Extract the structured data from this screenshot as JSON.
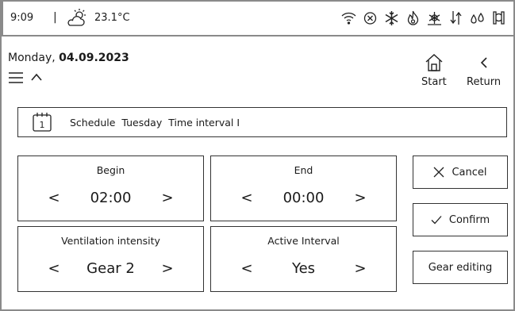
{
  "status_bar": {
    "time": "9:09",
    "separator": "|",
    "weather_icon": "sun-cloud-icon",
    "temperature": "23.1°C",
    "icons": [
      "wifi-icon",
      "circle-x-icon",
      "snowflake-icon",
      "flame-icon",
      "defrost-icon",
      "airflow-icon",
      "water-drops-icon",
      "filter-icon"
    ]
  },
  "header": {
    "date_prefix": "Monday,",
    "date": "04.09.2023",
    "nav": {
      "start_label": "Start",
      "return_label": "Return"
    }
  },
  "schedule": {
    "calendar_day": "1",
    "text": "Schedule  Tuesday  Time interval I"
  },
  "tiles": {
    "begin": {
      "label": "Begin",
      "value": "02:00"
    },
    "end": {
      "label": "End",
      "value": "00:00"
    },
    "ventilation": {
      "label": "Ventilation intensity",
      "value": "Gear 2"
    },
    "active": {
      "label": "Active Interval",
      "value": "Yes"
    },
    "arrow_left": "<",
    "arrow_right": ">"
  },
  "actions": {
    "cancel": "Cancel",
    "confirm": "Confirm",
    "gear_editing": "Gear editing"
  },
  "colors": {
    "border": "#333333",
    "frame": "#8a8a8a",
    "text": "#1a1a1a",
    "background": "#ffffff"
  }
}
